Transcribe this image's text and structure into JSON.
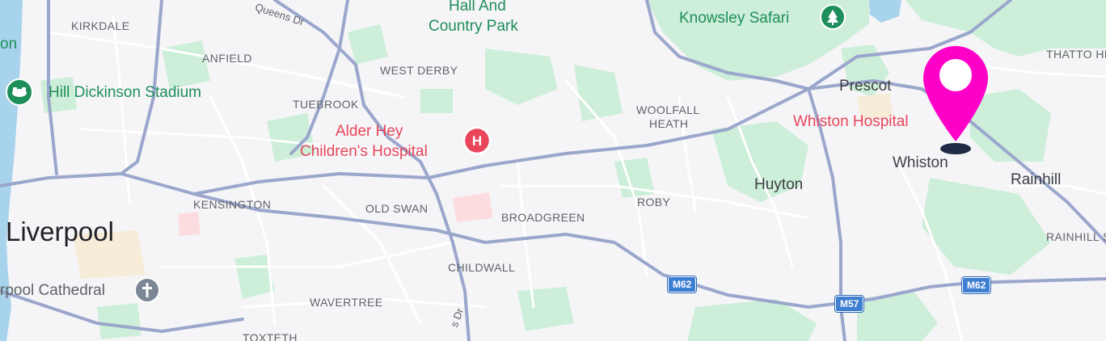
{
  "map": {
    "districts": {
      "kirkdale": "KIRKDALE",
      "anfield": "ANFIELD",
      "west_derby": "WEST DERBY",
      "tuebrook": "TUEBROOK",
      "woolfall_heath_1": "WOOLFALL",
      "woolfall_heath_2": "HEATH",
      "kensington": "KENSINGTON",
      "old_swan": "OLD SWAN",
      "broadgreen": "BROADGREEN",
      "roby": "ROBY",
      "childwall": "CHILDWALL",
      "wavertree": "WAVERTREE",
      "toxteth": "TOXTETH",
      "thatto_heath": "THATTO HE",
      "rainhill_stoops": "RAINHILL S"
    },
    "towns": {
      "prescot": "Prescot",
      "whiston": "Whiston",
      "huyton": "Huyton",
      "rainhill": "Rainhill"
    },
    "city": "Liverpool",
    "pois": {
      "hall_park_1": "Hall And",
      "hall_park_2": "Country Park",
      "knowsley_safari": "Knowsley Safari",
      "hill_dickinson": "Hill Dickinson Stadium",
      "alder_hey_1": "Alder Hey",
      "alder_hey_2": "Children's Hospital",
      "whiston_hospital": "Whiston Hospital",
      "cathedral": "rpool Cathedral",
      "edge_on": "on"
    },
    "roads": {
      "queens_dr_top": "Queens Dr",
      "queens_dr_bottom": "s Dr"
    },
    "shields": {
      "m62_a": "M62",
      "m57": "M57",
      "m62_b": "M62"
    },
    "marker": {
      "icon": "location-pin-icon",
      "color": "#ff00c8",
      "location": "Whiston"
    },
    "colors": {
      "land": "#f5f5f7",
      "park": "#cdeed9",
      "water": "#a7d3ec",
      "major_road": "#9aa6cc",
      "minor_road": "#ffffff",
      "hospital_red": "#e8455a",
      "motorway_shield": "#3f7fd1"
    }
  }
}
